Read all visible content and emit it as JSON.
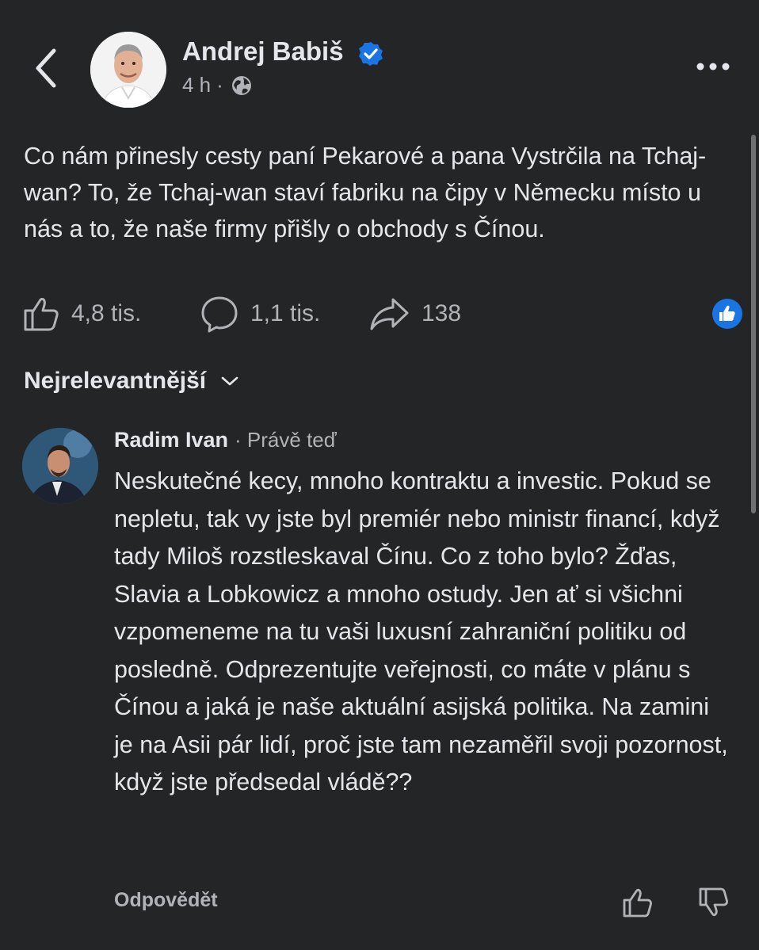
{
  "post": {
    "author": "Andrej Babiš",
    "time": "4 h",
    "separator": "·",
    "text": "Co nám přinesly cesty paní Pekarové a pana Vystrčila na Tchaj-wan? To, že Tchaj-wan staví fabriku na čipy v Německu místo u nás a to, že naše firmy přišly o obchody s Čínou.",
    "icons": {
      "back": "chevron-left-icon",
      "verified": "verified-badge-icon",
      "audience": "globe-icon",
      "more": "more-horizontal-icon"
    }
  },
  "actions": {
    "likes": "4,8 tis.",
    "comments": "1,1 tis.",
    "shares": "138"
  },
  "sort": {
    "label": "Nejrelevantnější"
  },
  "comment": {
    "author": "Radim Ivan",
    "time": "· Právě teď",
    "text": "Neskutečné kecy, mnoho kontraktu a investic. Pokud se nepletu, tak vy jste byl premiér nebo ministr financí, když tady Miloš rozstleskaval Čínu. Co z toho bylo? Žďas, Slavia a Lobkowicz a mnoho ostudy. Jen ať si všichni vzpomeneme na tu vaši luxusní zahraniční politiku od posledně. Odprezentujte veřejnosti, co máte v plánu s Čínou a jaká je naše aktuální asijská politika. Na zamini je na Asii pár lidí, proč jste tam nezaměřil svoji pozornost, když jste předsedal vládě??",
    "reply_label": "Odpovědět"
  },
  "colors": {
    "background": "#242526",
    "text_primary": "#e4e6eb",
    "text_secondary": "#b0b3b8",
    "accent": "#1b74e4"
  }
}
